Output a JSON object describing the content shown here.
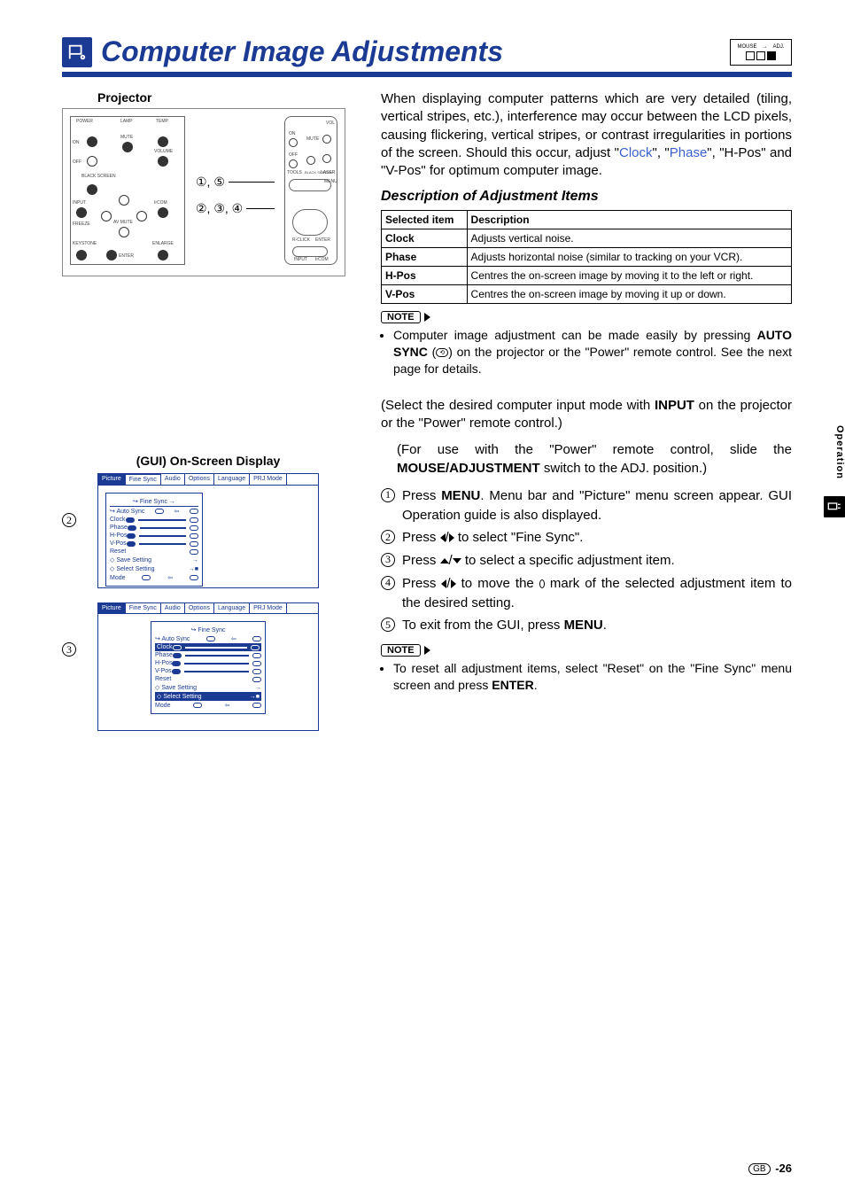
{
  "page_title": "Computer Image Adjustments",
  "switch_labels": {
    "mouse": "MOUSE",
    "adj": "ADJ."
  },
  "left": {
    "projector_label": "Projector",
    "remote_labels": {
      "power": "POWER",
      "lamp": "LAMP",
      "temp": "TEMP.",
      "on": "ON",
      "off": "OFF",
      "mute": "MUTE",
      "volume": "VOLUME",
      "black": "BLACK SCREEN",
      "tools": "TOOLS",
      "laser": "LASER",
      "menu": "MENU",
      "input": "INPUT",
      "freeze": "FREEZE",
      "keystone": "KEYSTONE",
      "av_mute": "AV MUTE",
      "enlarge": "ENLARGE",
      "enter": "ENTER",
      "ircom": "IrCOM",
      "rclick": "R-CLICK",
      "vol": "VOL",
      "input2": "INPUT",
      "ircom2": "IrCOM"
    },
    "callout_a": "①, ⑤",
    "callout_b": "②, ③, ④",
    "gui_heading": "(GUI) On-Screen Display",
    "gui_side_2": "②",
    "gui_side_3": "③",
    "gui_tabs": {
      "picture": "Picture",
      "fine_sync": "Fine Sync",
      "audio": "Audio",
      "options": "Options",
      "language": "Language",
      "prj": "PRJ Mode"
    },
    "gui_items": {
      "auto_sync": "Auto Sync",
      "clock": "Clock",
      "phase": "Phase",
      "hpos": "H-Pos",
      "vpos": "V-Pos",
      "reset": "Reset",
      "save": "Save Setting",
      "select": "Select Setting",
      "mode": "Mode"
    }
  },
  "intro": {
    "line1": "When displaying computer patterns which are very detailed (tiling, vertical stripes, etc.), interference may occur between the LCD pixels, causing flickering, vertical stripes, or contrast irregularities in portions of the screen. Should this occur, adjust \"",
    "clock": "Clock",
    "mid1": "\", \"",
    "phase": "Phase",
    "end1": "\", \"H-Pos\" and \"V-Pos\" for optimum computer image."
  },
  "desc_heading": "Description of Adjustment Items",
  "table": {
    "h1": "Selected item",
    "h2": "Description",
    "rows": [
      {
        "item": "Clock",
        "desc": "Adjusts vertical noise."
      },
      {
        "item": "Phase",
        "desc": "Adjusts horizontal noise (similar to tracking on your VCR)."
      },
      {
        "item": "H-Pos",
        "desc": "Centres the on-screen image by moving it to the left or right."
      },
      {
        "item": "V-Pos",
        "desc": "Centres the on-screen image by moving it up or down."
      }
    ]
  },
  "note1": {
    "label": "NOTE",
    "pre": "Computer image adjustment can be made easily by pressing ",
    "bold": "AUTO SYNC",
    "mid": " (",
    "post": ") on the projector or the \"Power\" remote control. See the next page for details."
  },
  "select_line": {
    "pre": "(Select the desired computer input mode with ",
    "bold": "INPUT",
    "post": " on the projector or the \"Power\" remote control.)"
  },
  "switch_line": {
    "pre": "(For use with the \"Power\" remote control, slide the ",
    "bold": "MOUSE/ADJUSTMENT",
    "post": " switch to the ADJ. position.)"
  },
  "steps": [
    {
      "n": "1",
      "pre": "Press ",
      "bold": "MENU",
      "post": ". Menu bar and \"Picture\" menu screen appear. GUI Operation guide is also displayed."
    },
    {
      "n": "2",
      "pre": "Press ",
      "arrows": "lr",
      "post": " to select \"Fine Sync\"."
    },
    {
      "n": "3",
      "pre": "Press ",
      "arrows": "ud",
      "post": " to select a specific adjustment item."
    },
    {
      "n": "4",
      "pre": "Press ",
      "arrows": "lr",
      "mid": " to move the ",
      "mark": true,
      "post": " mark of the selected adjustment item to the desired setting."
    },
    {
      "n": "5",
      "pre": "To exit from the GUI, press ",
      "bold": "MENU",
      "post": "."
    }
  ],
  "note2": {
    "label": "NOTE",
    "text_pre": "To reset all adjustment items, select \"Reset\" on the \"Fine Sync\" menu screen and press ",
    "bold": "ENTER",
    "text_post": "."
  },
  "side_tab": "Operation",
  "footer": {
    "gb": "GB",
    "page": "-26"
  }
}
